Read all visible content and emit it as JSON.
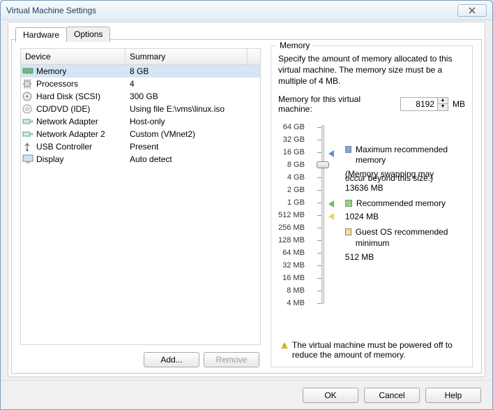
{
  "window": {
    "title": "Virtual Machine Settings"
  },
  "tabs": {
    "hardware": "Hardware",
    "options": "Options"
  },
  "table": {
    "head_device": "Device",
    "head_summary": "Summary",
    "rows": [
      {
        "icon": "memory-icon",
        "device": "Memory",
        "summary": "8 GB",
        "selected": true
      },
      {
        "icon": "cpu-icon",
        "device": "Processors",
        "summary": "4"
      },
      {
        "icon": "disk-icon",
        "device": "Hard Disk (SCSI)",
        "summary": "300 GB"
      },
      {
        "icon": "cd-icon",
        "device": "CD/DVD (IDE)",
        "summary": "Using file E:\\vms\\linux.iso"
      },
      {
        "icon": "net-icon",
        "device": "Network Adapter",
        "summary": "Host-only"
      },
      {
        "icon": "net-icon",
        "device": "Network Adapter 2",
        "summary": "Custom (VMnet2)"
      },
      {
        "icon": "usb-icon",
        "device": "USB Controller",
        "summary": "Present"
      },
      {
        "icon": "display-icon",
        "device": "Display",
        "summary": "Auto detect"
      }
    ]
  },
  "left_buttons": {
    "add": "Add...",
    "remove": "Remove"
  },
  "memory": {
    "group_label": "Memory",
    "desc": "Specify the amount of memory allocated to this virtual machine. The memory size must be a multiple of 4 MB.",
    "field_label": "Memory for this virtual machine:",
    "value": "8192",
    "unit": "MB",
    "ticks": [
      "64 GB",
      "32 GB",
      "16 GB",
      "8 GB",
      "4 GB",
      "2 GB",
      "1 GB",
      "512 MB",
      "256 MB",
      "128 MB",
      "64 MB",
      "32 MB",
      "16 MB",
      "8 MB",
      "4 MB"
    ],
    "max_label": "Maximum recommended memory",
    "max_note1": "(Memory swapping may",
    "max_note2": "occur beyond this size.)",
    "max_value": "13636 MB",
    "rec_label": "Recommended memory",
    "rec_value": "1024 MB",
    "min_label": "Guest OS recommended minimum",
    "min_value": "512 MB",
    "warn": "The virtual machine must be powered off to reduce the amount of memory."
  },
  "footer": {
    "ok": "OK",
    "cancel": "Cancel",
    "help": "Help"
  }
}
